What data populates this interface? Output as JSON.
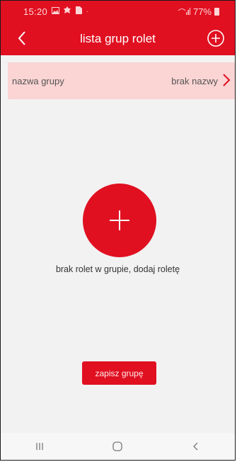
{
  "status_bar": {
    "time": "15:20",
    "battery": "77%",
    "icons": [
      "gallery-icon",
      "notification-icon",
      "sim-icon",
      "signal-icon",
      "battery-icon"
    ]
  },
  "app_bar": {
    "title": "lista grup rolet",
    "back_icon": "chevron-left-icon",
    "add_icon": "plus-circle-icon"
  },
  "group": {
    "label": "nazwa grupy",
    "value": "brak nazwy"
  },
  "empty_state": {
    "message": "brak rolet w grupie, dodaj roletę",
    "add_icon": "plus-icon"
  },
  "save_button": "zapisz grupę",
  "nav_bar": [
    "recents-icon",
    "home-icon",
    "back-icon"
  ],
  "colors": {
    "accent": "#e01021",
    "row_bg": "#fbd4d4",
    "background": "#f2f2f2"
  }
}
